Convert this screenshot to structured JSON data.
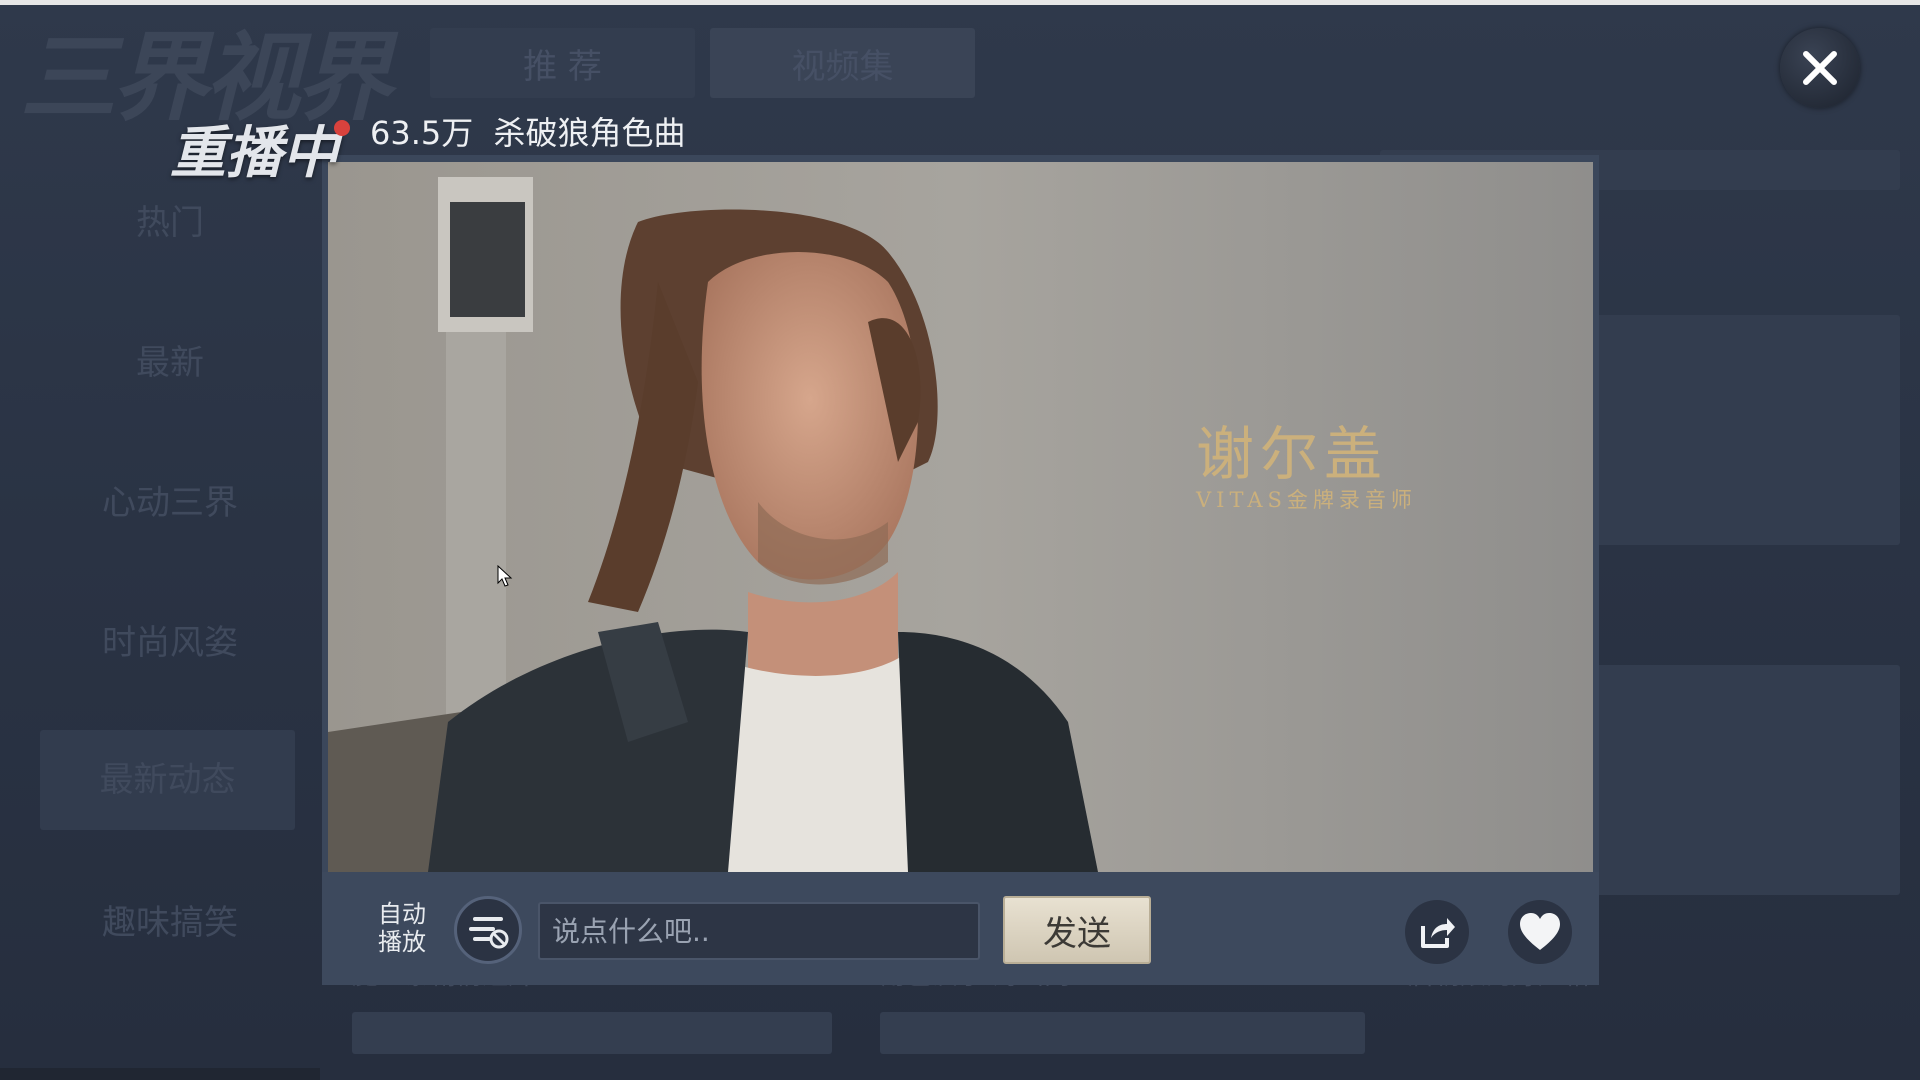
{
  "app": {
    "logo_text": "三界视界"
  },
  "tabs": [
    {
      "label": "推 荐"
    },
    {
      "label": "视频集"
    }
  ],
  "sidebar": {
    "items": [
      {
        "label": "热门"
      },
      {
        "label": "最新"
      },
      {
        "label": "心动三界"
      },
      {
        "label": "时尚风姿"
      },
      {
        "label": "最新动态"
      },
      {
        "label": "趣味搞笑"
      }
    ],
    "selected": "最新动态"
  },
  "background_cards": [
    {
      "label": "魔王寨剧情短片"
    },
    {
      "label": "角色演示·海山网"
    },
    {
      "label": "唐朝娘的好严格"
    }
  ],
  "player": {
    "status": "重播中",
    "view_count": "63.5万",
    "title": "杀破狼角色曲",
    "caption_name": "谢尔盖",
    "caption_role": "VITAS金牌录音师"
  },
  "controls": {
    "autoplay_label": "自动播放",
    "comment_placeholder": "说点什么吧..",
    "send_label": "发送"
  },
  "icons": {
    "close": "close-icon",
    "share": "share-icon",
    "like": "heart-icon",
    "danmaku": "danmaku-toggle-icon",
    "autoplay": "autoplay-check-icon"
  },
  "colors": {
    "background": "#2a3344",
    "panel": "#3d495d",
    "accent_gold": "#cbb07c",
    "send_button": "#e0d8c6",
    "live_dot": "#d8423d"
  }
}
